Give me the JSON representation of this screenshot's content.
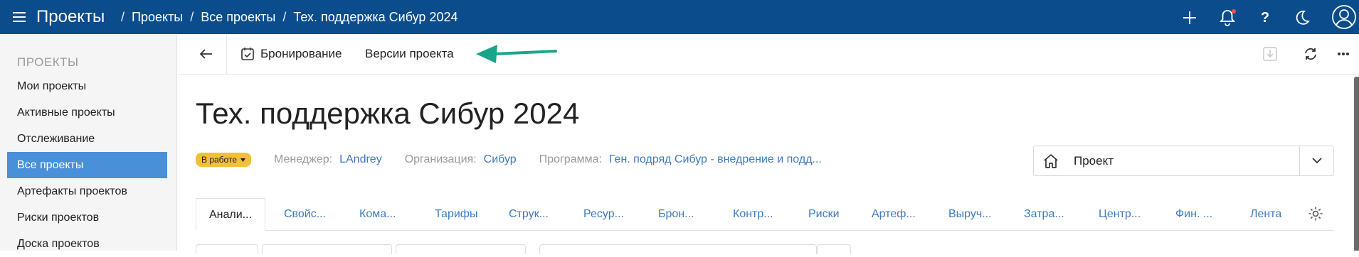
{
  "topbar": {
    "app_title": "Проекты",
    "breadcrumb": [
      "Проекты",
      "Все проекты",
      "Тех. поддержка Сибур 2024"
    ],
    "separator": "/",
    "icons": [
      "plus-icon",
      "bell-icon",
      "help-icon",
      "moon-icon",
      "user-icon"
    ],
    "help_glyph": "?"
  },
  "sidebar": {
    "heading": "ПРОЕКТЫ",
    "items": [
      {
        "label": "Мои проекты"
      },
      {
        "label": "Активные проекты"
      },
      {
        "label": "Отслеживание"
      },
      {
        "label": "Все проекты",
        "active": true
      },
      {
        "label": "Артефакты проектов"
      },
      {
        "label": "Риски проектов"
      },
      {
        "label": "Доска проектов"
      }
    ]
  },
  "toolbar": {
    "booking_label": "Бронирование",
    "versions_label": "Версии проекта"
  },
  "project": {
    "title": "Тех. поддержка Сибур 2024",
    "status": "В работе",
    "manager_label": "Менеджер:",
    "manager_value": "LAndrey",
    "org_label": "Организация:",
    "org_value": "Сибур",
    "program_label": "Программа:",
    "program_value": "Ген. подряд Сибур - внедрение и подд...",
    "type_value": "Проект"
  },
  "tabs": [
    {
      "label": "Анали...",
      "active": true
    },
    {
      "label": "Свойс..."
    },
    {
      "label": "Кома..."
    },
    {
      "label": "Тарифы"
    },
    {
      "label": "Струк..."
    },
    {
      "label": "Ресур..."
    },
    {
      "label": "Брон..."
    },
    {
      "label": "Контр..."
    },
    {
      "label": "Риски"
    },
    {
      "label": "Артеф..."
    },
    {
      "label": "Выруч..."
    },
    {
      "label": "Затра..."
    },
    {
      "label": "Центр..."
    },
    {
      "label": "Фин. ..."
    },
    {
      "label": "Лента"
    }
  ],
  "colors": {
    "topbar": "#0b4c8c",
    "sidebar_active": "#4a90d9",
    "link": "#3d7ac0",
    "status_badge": "#f2c037",
    "annotation_arrow": "#1aa58a"
  }
}
